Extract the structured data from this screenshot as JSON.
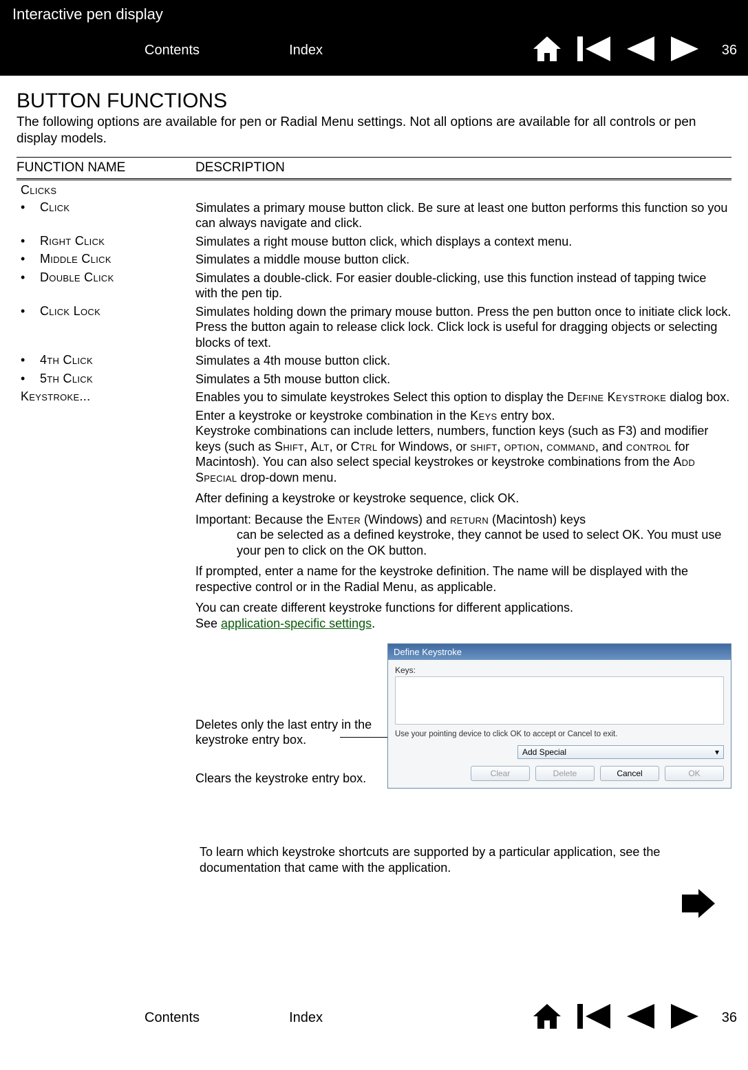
{
  "header": {
    "product_title": "Interactive pen display",
    "contents_link": "Contents",
    "index_link": "Index",
    "page_number": "36"
  },
  "main": {
    "heading": "BUTTON FUNCTIONS",
    "intro": "The following options are available for pen or Radial Menu settings.  Not all options are available for all controls or pen display models.",
    "table_headers": {
      "name": "FUNCTION NAME",
      "desc": "DESCRIPTION"
    },
    "section_clicks": "Clicks",
    "rows": {
      "click": {
        "name": "Click",
        "desc": "Simulates a primary mouse button click.  Be sure at least one button performs this function so you can always navigate and click."
      },
      "right_click": {
        "name": "Right Click",
        "desc": "Simulates a right mouse button click, which displays a context menu."
      },
      "middle_click": {
        "name": "Middle Click",
        "desc": "Simulates a middle mouse button click."
      },
      "double_click": {
        "name": "Double Click",
        "desc": "Simulates a double-click.  For easier double-clicking, use this function instead of tapping twice with the pen tip."
      },
      "click_lock": {
        "name": "Click Lock",
        "desc": "Simulates holding down the primary mouse button.  Press the pen button once to initiate click lock.  Press the button again to release click lock.  Click lock is useful for dragging objects or selecting blocks of text."
      },
      "fourth_click": {
        "name": "4th Click",
        "desc": "Simulates a 4th mouse button click."
      },
      "fifth_click": {
        "name": "5th Click",
        "desc": "Simulates a 5th mouse button click."
      },
      "keystroke": {
        "name": "Keystroke...",
        "desc_pre": "Enables you to simulate keystrokes  Select this option to display the ",
        "desc_sc1": "Define Keystroke",
        "desc_post": " dialog box."
      }
    },
    "keystroke_paras": {
      "p1_a": "Enter a keystroke or keystroke combination in the ",
      "p1_keys": "Keys",
      "p1_b": " entry box.",
      "p2_a": "Keystroke combinations can include letters, numbers, function keys (such as F3) and modifier keys (such as ",
      "p2_shift": "Shift",
      "p2_c1": ", ",
      "p2_alt": "Alt",
      "p2_c2": ", or ",
      "p2_ctrl": "Ctrl",
      "p2_c3": " for Windows, or ",
      "p2_shift2": "shift",
      "p2_c4": ", ",
      "p2_option": "option",
      "p2_c5": ", ",
      "p2_command": "command",
      "p2_c6": ", and ",
      "p2_control": "control",
      "p2_c7": " for Macintosh).  You can also select special keystrokes or keystroke combinations from the ",
      "p2_addspecial": "Add Special",
      "p2_c8": " drop-down menu.",
      "p3": "After defining a keystroke or keystroke sequence, click OK.",
      "p4_a": "Important: Because the ",
      "p4_enter": "Enter",
      "p4_b": " (Windows) and ",
      "p4_return": "return",
      "p4_c": " (Macintosh) keys",
      "p4_indent": "can be selected as a defined keystroke, they cannot be used to select OK.  You must use your pen to click on the OK button.",
      "p5": "If prompted, enter a name for the keystroke definition.  The name will be displayed with the respective control or in the Radial Menu, as applicable.",
      "p6_a": "You can create different keystroke functions for different applications.",
      "p6_see": "See ",
      "p6_link": "application-specific settings",
      "p6_dot": "."
    },
    "callouts": {
      "delete_note": "Deletes only the last entry in the keystroke entry box.",
      "clear_note": "Clears the keystroke entry box."
    },
    "dialog": {
      "title": "Define Keystroke",
      "keys_label": "Keys:",
      "hint": "Use your pointing device to click OK to accept or Cancel to exit.",
      "add_special": "Add Special",
      "clear": "Clear",
      "delete": "Delete",
      "cancel": "Cancel",
      "ok": "OK"
    },
    "learn": "To learn which keystroke shortcuts are supported by a particular application, see the documentation that came with the application."
  },
  "footer": {
    "contents_link": "Contents",
    "index_link": "Index",
    "page_number": "36"
  }
}
